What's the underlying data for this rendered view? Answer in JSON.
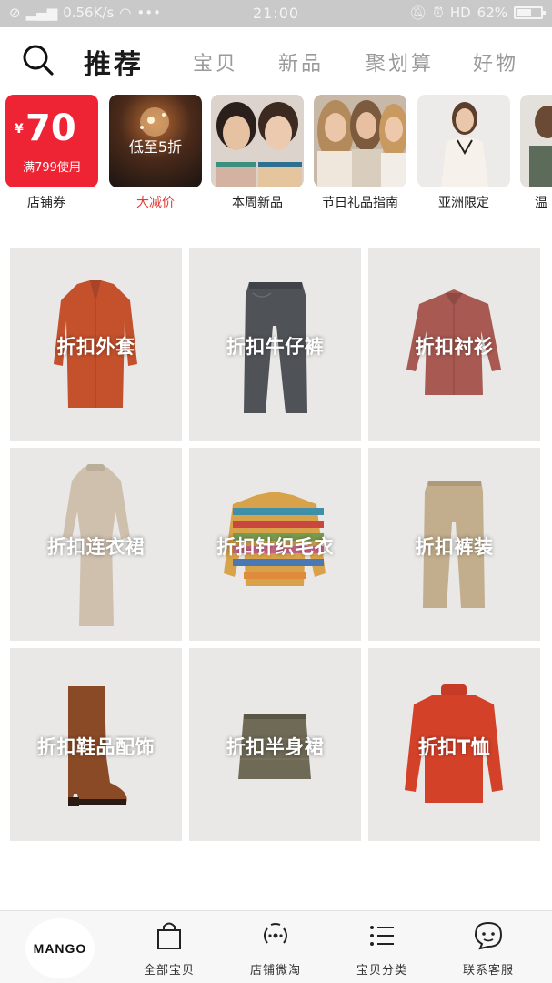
{
  "status_bar": {
    "speed": "0.56K/s",
    "time": "21:00",
    "battery": "62%",
    "battery_level": 0.62
  },
  "header": {
    "tabs": [
      {
        "label": "推荐",
        "active": true
      },
      {
        "label": "宝贝",
        "active": false
      },
      {
        "label": "新品",
        "active": false
      },
      {
        "label": "聚划算",
        "active": false
      },
      {
        "label": "好物",
        "active": false
      }
    ]
  },
  "promos": [
    {
      "label": "店铺券",
      "currency": "¥",
      "amount": "70",
      "condition": "满799使用",
      "accent": "#ee2435"
    },
    {
      "label": "大减价",
      "overlay": "低至5折",
      "label_color": "#e53935"
    },
    {
      "label": "本周新品"
    },
    {
      "label": "节日礼品指南"
    },
    {
      "label": "亚洲限定"
    },
    {
      "label": "温"
    }
  ],
  "categories": [
    {
      "label": "折扣外套",
      "icon": "coat"
    },
    {
      "label": "折扣牛仔裤",
      "icon": "jeans"
    },
    {
      "label": "折扣衬衫",
      "icon": "shirt"
    },
    {
      "label": "折扣连衣裙",
      "icon": "dress"
    },
    {
      "label": "折扣针织毛衣",
      "icon": "sweater"
    },
    {
      "label": "折扣裤装",
      "icon": "trousers"
    },
    {
      "label": "折扣鞋品配饰",
      "icon": "boot"
    },
    {
      "label": "折扣半身裙",
      "icon": "skirt"
    },
    {
      "label": "折扣T恤",
      "icon": "turtleneck"
    }
  ],
  "bottom_nav": {
    "logo": "MANGO",
    "items": [
      {
        "label": "全部宝贝",
        "icon": "shopping-bag-icon"
      },
      {
        "label": "店铺微淘",
        "icon": "broadcast-icon"
      },
      {
        "label": "宝贝分类",
        "icon": "list-icon"
      },
      {
        "label": "联系客服",
        "icon": "chat-face-icon"
      }
    ]
  }
}
